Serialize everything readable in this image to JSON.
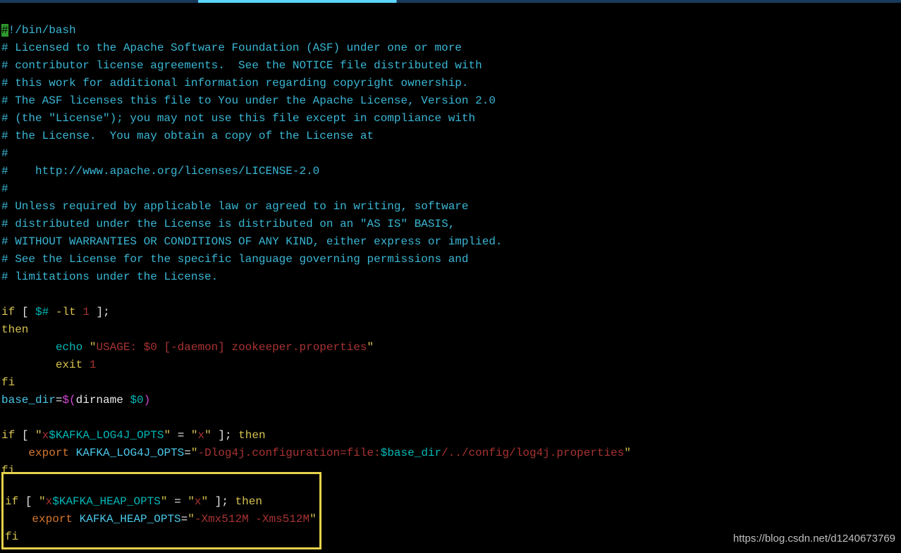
{
  "shebang": {
    "hash": "#",
    "rest": "!/bin/bash"
  },
  "comments": [
    "# Licensed to the Apache Software Foundation (ASF) under one or more",
    "# contributor license agreements.  See the NOTICE file distributed with",
    "# this work for additional information regarding copyright ownership.",
    "# The ASF licenses this file to You under the Apache License, Version 2.0",
    "# (the \"License\"); you may not use this file except in compliance with",
    "# the License.  You may obtain a copy of the License at",
    "#",
    "#    http://www.apache.org/licenses/LICENSE-2.0",
    "#",
    "# Unless required by applicable law or agreed to in writing, software",
    "# distributed under the License is distributed on an \"AS IS\" BASIS,",
    "# WITHOUT WARRANTIES OR CONDITIONS OF ANY KIND, either express or implied.",
    "# See the License for the specific language governing permissions and",
    "# limitations under the License."
  ],
  "block1": {
    "if": "if",
    "lbr": "[",
    "var": "$#",
    "op": "-lt",
    "num": "1",
    "rbr": "];",
    "then": "then",
    "echo_kw": "echo",
    "echo_q1": "\"",
    "echo_str": "USAGE: $0 [-daemon] zookeeper.properties",
    "echo_q2": "\"",
    "exit_kw": "exit",
    "exit_code": "1",
    "fi": "fi"
  },
  "basedir": {
    "var": "base_dir",
    "eq": "=",
    "dollar_open": "$(",
    "dirname": "dirname",
    "arg": "$0",
    "close": ")"
  },
  "block2": {
    "if": "if",
    "lbr": "[",
    "q1": "\"",
    "pfx": "x",
    "dvar": "$KAFKA_LOG4J_OPTS",
    "q2": "\"",
    "eq": "=",
    "q3": "\"",
    "x2": "x",
    "q4": "\"",
    "rbr": "]; ",
    "then": "then",
    "export": "export",
    "var": "KAFKA_LOG4J_OPTS",
    "assign": "=",
    "sq1": "\"",
    "flag": "-Dlog4j.configuration=file:",
    "dvar2": "$base_dir",
    "tail": "/../config/log4j.properties",
    "sq2": "\"",
    "fi": "fi"
  },
  "block3": {
    "if": "if",
    "lbr": "[",
    "q1": "\"",
    "pfx": "x",
    "dvar": "$KAFKA_HEAP_OPTS",
    "q2": "\"",
    "eq": "=",
    "q3": "\"",
    "x2": "x",
    "q4": "\"",
    "rbr": "]; ",
    "then": "then",
    "export": "export",
    "var": "KAFKA_HEAP_OPTS",
    "assign": "=",
    "sq1": "\"",
    "flag": "-Xmx512M -Xms512M",
    "sq2": "\"",
    "fi": "fi"
  },
  "watermark": "https://blog.csdn.net/d1240673769"
}
